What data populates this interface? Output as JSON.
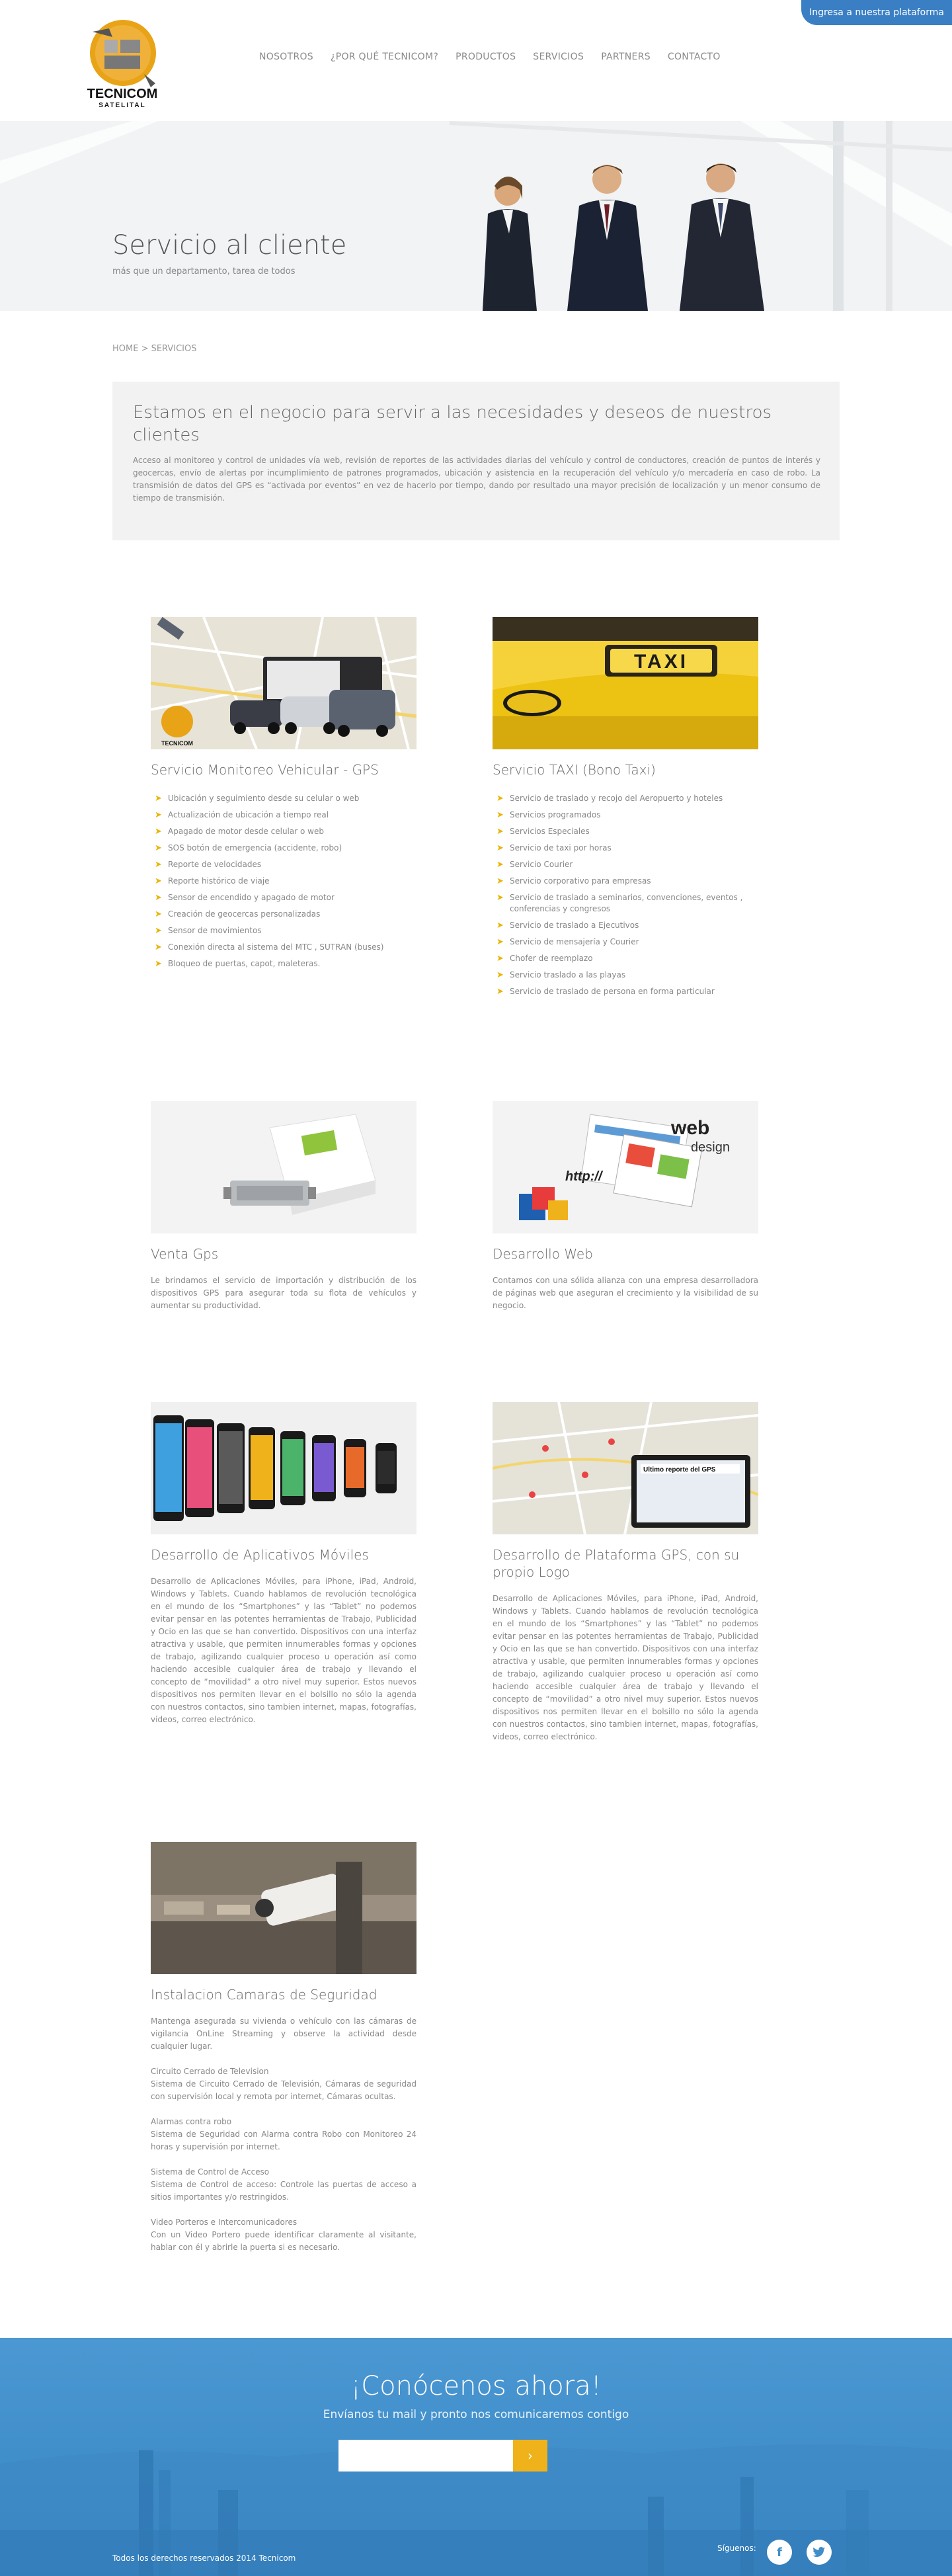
{
  "top_button": "Ingresa a nuestra plataforma",
  "logo": {
    "name": "TECNICOM",
    "tagline": "SATELITAL"
  },
  "nav": [
    "NOSOTROS",
    "¿POR QUÉ TECNICOM?",
    "PRODUCTOS",
    "SERVICIOS",
    "PARTNERS",
    "CONTACTO"
  ],
  "hero": {
    "title": "Servicio al cliente",
    "subtitle": "más que un departamento, tarea de todos"
  },
  "breadcrumb": "HOME > SERVICIOS",
  "intro": {
    "title": "Estamos en el negocio para servir a las necesidades y deseos de nuestros clientes",
    "text": "Acceso al monitoreo y control de unidades vía web, revisión de reportes de las actividades diarias del vehículo y control de conductores, creación de puntos de interés y geocercas, envío de alertas por incumplimiento de patrones programados, ubicación y asistencia en la recuperación del vehículo y/o mercadería en caso de robo. La transmisión de datos del GPS es “activada por eventos” en vez de hacerlo por tiempo, dando por resultado una mayor precisión de localización y un menor consumo de tiempo de transmisión."
  },
  "services": {
    "s1": {
      "title": "Servicio Monitoreo Vehicular - GPS",
      "items": [
        "Ubicación y seguimiento desde su celular o web",
        "Actualización de ubicación a tiempo real",
        "Apagado de motor desde celular o web",
        "SOS botón de emergencia (accidente, robo)",
        "Reporte de velocidades",
        "Reporte histórico de viaje",
        "Sensor de encendido y apagado de motor",
        "Creación de geocercas personalizadas",
        "Sensor de movimientos",
        "Conexión directa al sistema del MTC , SUTRAN (buses)",
        "Bloqueo de puertas, capot, maleteras."
      ]
    },
    "s2": {
      "title": "Servicio TAXI (Bono Taxi)",
      "sign": "TAXI",
      "items": [
        "Servicio de traslado y recojo del Aeropuerto y hoteles",
        "Servicios programados",
        "Servicios Especiales",
        "Servicio de taxi por horas",
        "Servicio Courier",
        "Servicio corporativo para empresas",
        "Servicio de traslado a seminarios, convenciones, eventos , conferencias y congresos",
        "Servicio de traslado a Ejecutivos",
        "Servicio de mensajería y Courier",
        "Chofer de reemplazo",
        "Servicio traslado a las playas",
        "Servicio de traslado de persona en forma particular"
      ]
    },
    "s3": {
      "title": "Venta Gps",
      "text": "Le brindamos el servicio de importación y distribución de los dispositivos GPS para asegurar toda su flota de vehículos y aumentar su productividad."
    },
    "s4": {
      "title": "Desarrollo Web",
      "img_text1": "web",
      "img_text2": "design",
      "img_text3": "http://",
      "text": "Contamos con una sólida alianza con una empresa desarrolladora de páginas web que aseguran el crecimiento y la visibilidad de su negocio."
    },
    "s5": {
      "title": "Desarrollo de Aplicativos Móviles",
      "text": "Desarrollo de Aplicaciones Móviles, para iPhone, iPad, Android, Windows y Tablets. Cuando hablamos de revolución tecnológica en el mundo de los “Smartphones” y las “Tablet” no podemos evitar pensar en las potentes herramientas de Trabajo, Publicidad y Ocio en las que se han convertido. Dispositivos con una interfaz atractiva y usable, que permiten innumerables formas y opciones de trabajo, agilizando cualquier proceso u operación así como haciendo accesible cualquier área de trabajo y llevando el concepto de “movilidad” a otro nivel muy superior. Estos nuevos dispositivos nos permiten llevar en el bolsillo no sólo la agenda con nuestros contactos, sino tambien internet, mapas, fotografías, videos, correo electrónico."
    },
    "s6": {
      "title": "Desarrollo de Plataforma GPS, con su propio Logo",
      "img_text": "Ultimo reporte del GPS",
      "text": "Desarrollo de Aplicaciones Móviles, para iPhone, iPad, Android, Windows y Tablets. Cuando hablamos de revolución tecnológica en el mundo de los “Smartphones” y las “Tablet” no podemos evitar pensar en las potentes herramientas de Trabajo, Publicidad y Ocio en las que se han convertido. Dispositivos con una interfaz atractiva y usable, que permiten innumerables formas y opciones de trabajo, agilizando cualquier proceso u operación así como haciendo accesible cualquier área de trabajo y llevando el concepto de “movilidad” a otro nivel muy superior. Estos nuevos dispositivos nos permiten llevar en el bolsillo no sólo la agenda con nuestros contactos, sino tambien internet, mapas, fotografías, videos, correo electrónico."
    },
    "s7": {
      "title": "Instalacion Camaras de Seguridad",
      "text": "Mantenga asegurada su vivienda o vehículo con las cámaras de vigilancia OnLine Streaming y observe la actividad desde cualquier lugar.\n\nCircuito Cerrado de Television\nSistema de Circuito Cerrado de Televisión, Cámaras de seguridad con supervisión local y remota por internet, Cámaras ocultas.\n\nAlarmas contra robo\nSistema de Seguridad con Alarma contra Robo con Monitoreo 24 horas y supervisión por internet.\n\nSistema de Control de Acceso\nSistema de Control de acceso: Controle las puertas de acceso a sitios importantes y/o restringidos.\n\nVideo Porteros e Intercomunicadores\nCon un Video Portero puede identificar claramente al visitante, hablar con él y abrirle la puerta si es necesario."
    }
  },
  "footer": {
    "title": "¡Conócenos ahora!",
    "subtitle": "Envíanos tu mail y pronto nos comunicaremos contigo",
    "copyright": "Todos los derechos reservados 2014 Tecnicom",
    "follow": "Síguenos:"
  },
  "colors": {
    "accent": "#3a7fc4",
    "arrow": "#e8b400",
    "footer": "#4592cd",
    "send": "#f0b21a"
  },
  "icons": [
    "chevron-right-icon",
    "facebook-icon",
    "twitter-icon"
  ]
}
